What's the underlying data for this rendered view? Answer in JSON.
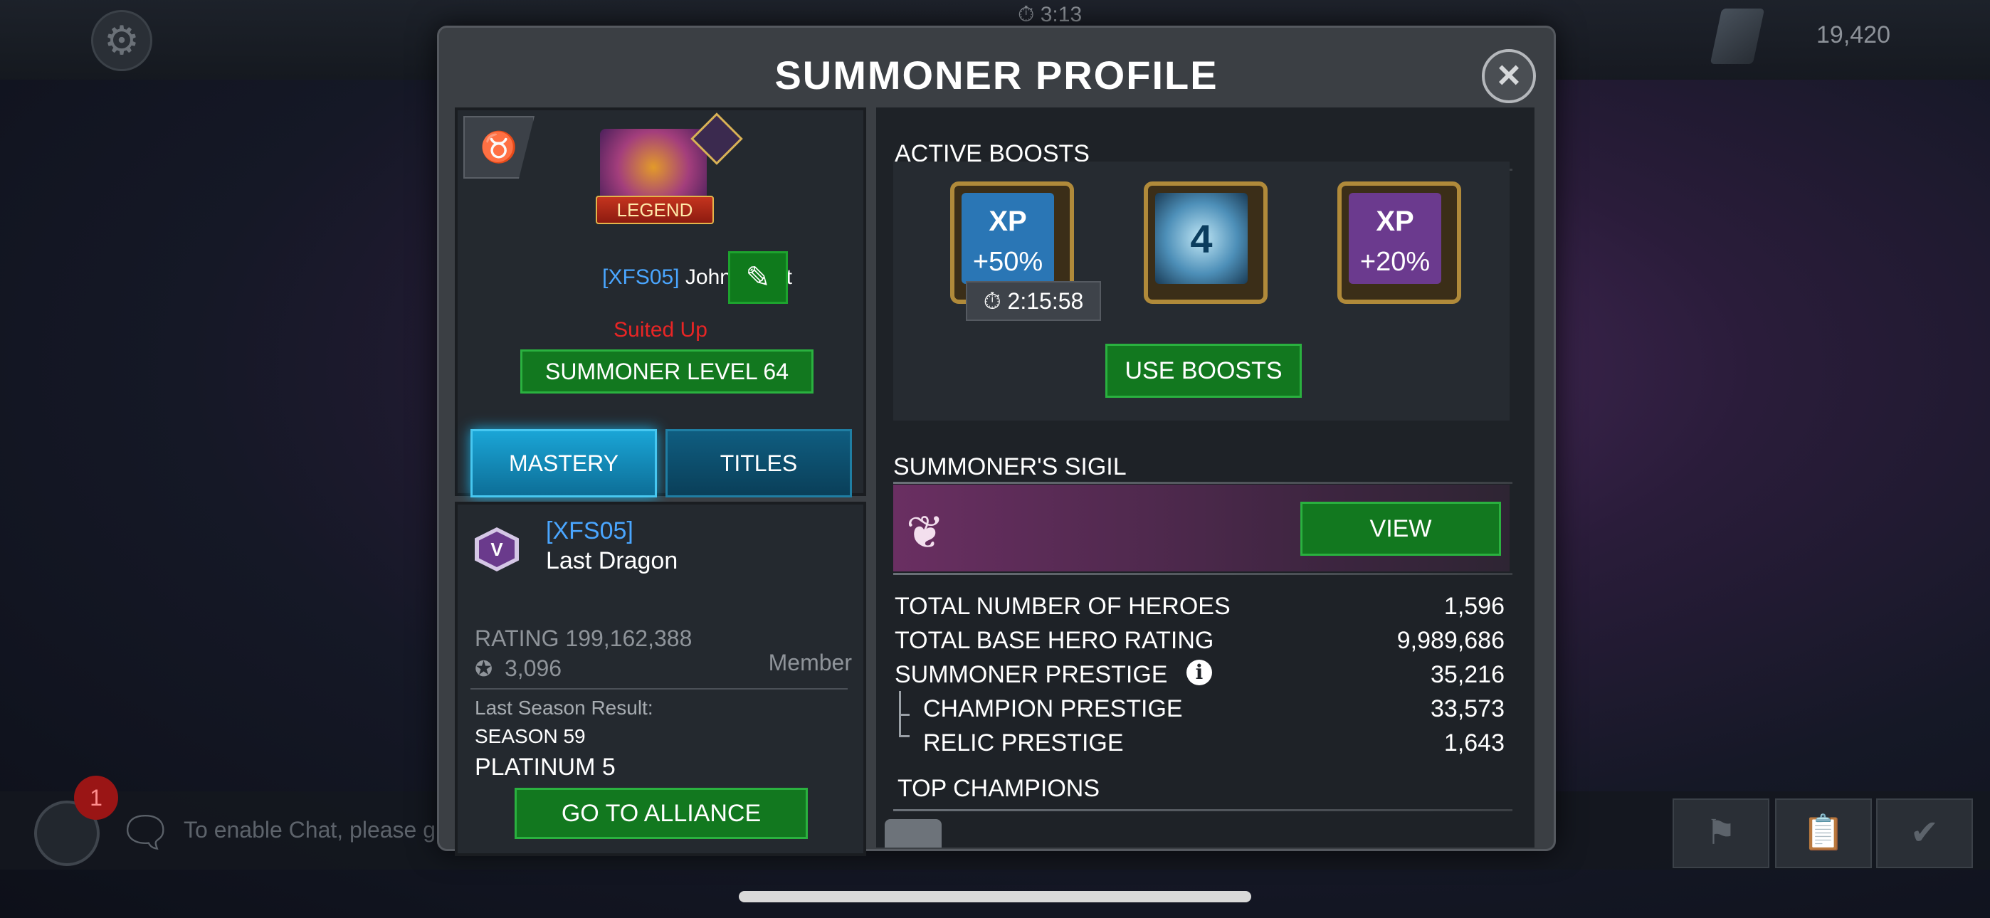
{
  "hud": {
    "timer": "3:13",
    "units": "19,420",
    "chat_badge": "1",
    "chat_placeholder": "To enable Chat, please g"
  },
  "modal": {
    "title": "SUMMONER PROFILE",
    "close_label": "×"
  },
  "profile": {
    "avatar_badge": "LEGEND",
    "alliance_tag": "[XFS05]",
    "name": "JohnnyRiot",
    "status": "Suited Up",
    "level_button": "SUMMONER LEVEL 64",
    "mastery_button": "MASTERY",
    "titles_button": "TITLES"
  },
  "alliance": {
    "tag": "[XFS05]",
    "name": "Last Dragon",
    "rating": "RATING 199,162,388",
    "count": "3,096",
    "role": "Member",
    "last_season_label": "Last Season Result:",
    "season": "SEASON 59",
    "tier": "PLATINUM 5",
    "go_button": "GO TO ALLIANCE"
  },
  "boosts": {
    "title": "ACTIVE BOOSTS",
    "items": [
      {
        "icon": "xp-boost-icon",
        "label": "XP",
        "value": "+50%",
        "color": "#2a76b5"
      },
      {
        "icon": "fantastic-four-boost-icon",
        "label": "",
        "value": "",
        "color": "#4d8fb8"
      },
      {
        "icon": "xp-boost-icon",
        "label": "XP",
        "value": "+20%",
        "color": "#6b3a8e"
      }
    ],
    "timer": "2:15:58",
    "use_button": "USE BOOSTS"
  },
  "sigil": {
    "title": "SUMMONER'S SIGIL",
    "view_button": "VIEW"
  },
  "stats": [
    {
      "label": "TOTAL NUMBER OF HEROES",
      "value": "1,596"
    },
    {
      "label": "TOTAL BASE HERO RATING",
      "value": "9,989,686"
    },
    {
      "label": "SUMMONER PRESTIGE",
      "value": "35,216"
    },
    {
      "label": "CHAMPION PRESTIGE",
      "value": "33,573"
    },
    {
      "label": "RELIC PRESTIGE",
      "value": "1,643"
    }
  ],
  "top_champions": {
    "title": "TOP CHAMPIONS"
  }
}
